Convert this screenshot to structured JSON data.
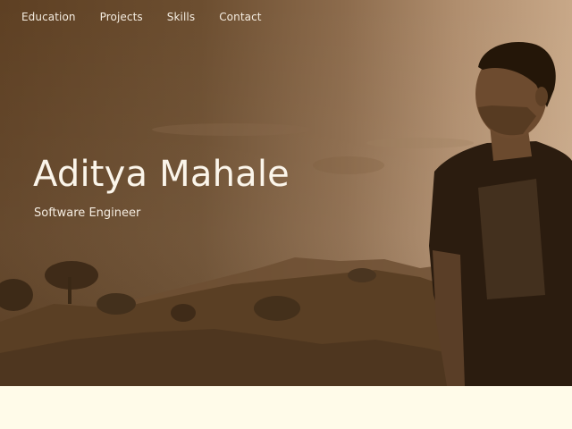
{
  "nav": {
    "items": [
      {
        "label": "Education"
      },
      {
        "label": "Projects"
      },
      {
        "label": "Skills"
      },
      {
        "label": "Contact"
      }
    ]
  },
  "hero": {
    "name": "Aditya Mahale",
    "title": "Software Engineer"
  },
  "colors": {
    "hero_dark": "#5e4023",
    "hero_light": "#c8a888",
    "text_light": "#fbf5ea",
    "page_background": "#fffbe9"
  }
}
